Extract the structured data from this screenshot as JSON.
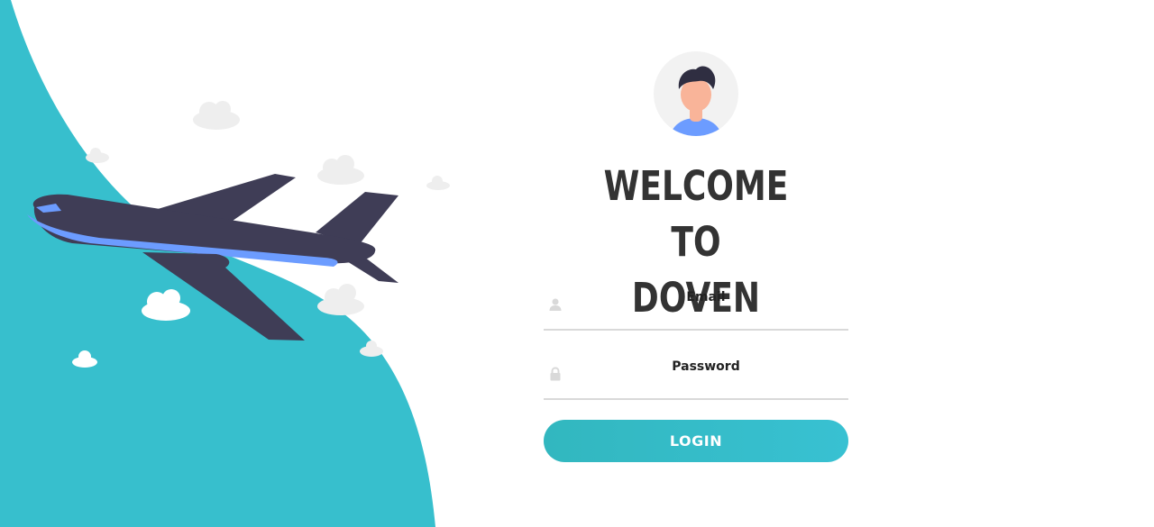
{
  "colors": {
    "accent": "#37bfcd",
    "plane_body": "#3f3d56",
    "plane_stripe": "#6c9cff",
    "title_text": "#333333"
  },
  "illustration": {
    "plane_icon": "airplane-illustration",
    "cloud_icon": "cloud-icon"
  },
  "login": {
    "avatar_icon": "user-avatar",
    "title_line1": "WELCOME TO",
    "title_line2": "DOVEN",
    "email": {
      "placeholder": "Email",
      "value": "",
      "icon": "user-icon"
    },
    "password": {
      "placeholder": "Password",
      "value": "",
      "icon": "lock-icon"
    },
    "button_label": "LOGIN"
  }
}
